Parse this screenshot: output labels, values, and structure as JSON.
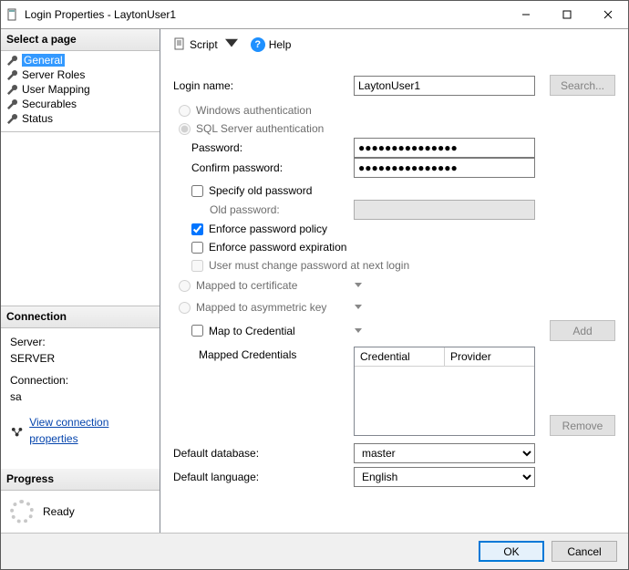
{
  "window": {
    "title": "Login Properties - LaytonUser1"
  },
  "toolbar": {
    "script_label": "Script",
    "help_label": "Help"
  },
  "left": {
    "select_page": "Select a page",
    "pages": [
      {
        "label": "General"
      },
      {
        "label": "Server Roles"
      },
      {
        "label": "User Mapping"
      },
      {
        "label": "Securables"
      },
      {
        "label": "Status"
      }
    ],
    "connection_header": "Connection",
    "server_label": "Server:",
    "server_value": "SERVER",
    "connection_label": "Connection:",
    "connection_value": "sa",
    "view_props": "View connection properties",
    "progress_header": "Progress",
    "progress_status": "Ready"
  },
  "form": {
    "login_name_label": "Login name:",
    "login_name_value": "LaytonUser1",
    "search_btn": "Search...",
    "win_auth": "Windows authentication",
    "sql_auth": "SQL Server authentication",
    "password_label": "Password:",
    "password_value": "●●●●●●●●●●●●●●●",
    "confirm_label": "Confirm password:",
    "confirm_value": "●●●●●●●●●●●●●●●",
    "specify_old": "Specify old password",
    "old_password_label": "Old password:",
    "enforce_policy": "Enforce password policy",
    "enforce_expiration": "Enforce password expiration",
    "must_change": "User must change password at next login",
    "mapped_cert": "Mapped to certificate",
    "mapped_asym": "Mapped to asymmetric key",
    "map_credential": "Map to Credential",
    "add_btn": "Add",
    "mapped_creds_label": "Mapped Credentials",
    "col_credential": "Credential",
    "col_provider": "Provider",
    "remove_btn": "Remove",
    "default_db_label": "Default database:",
    "default_db_value": "master",
    "default_lang_label": "Default language:",
    "default_lang_value": "English"
  },
  "dialog": {
    "ok": "OK",
    "cancel": "Cancel"
  }
}
